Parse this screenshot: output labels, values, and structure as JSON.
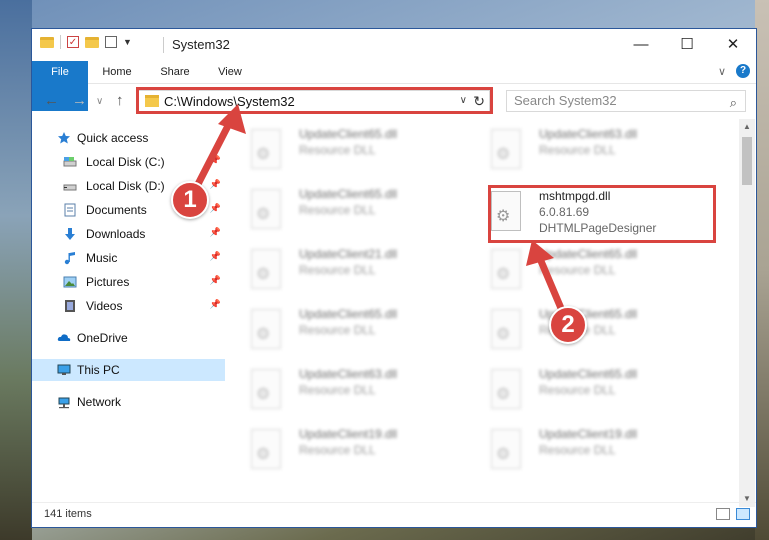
{
  "window": {
    "title": "System32",
    "minimize_glyph": "—",
    "maximize_glyph": "☐",
    "close_glyph": "✕"
  },
  "ribbon": {
    "tabs": [
      "File",
      "Home",
      "Share",
      "View"
    ],
    "expand_glyph": "∨",
    "help_glyph": "?"
  },
  "nav": {
    "back_glyph": "←",
    "forward_glyph": "→",
    "recent_glyph": "∨",
    "up_glyph": "↑",
    "address": "C:\\Windows\\System32",
    "address_caret": "∨",
    "refresh_glyph": "↻",
    "search_placeholder": "Search System32",
    "search_glyph": "⌕"
  },
  "sidebar": {
    "items": [
      {
        "label": "Quick access",
        "icon": "star-icon"
      },
      {
        "label": "Local Disk (C:)",
        "icon": "drive-icon"
      },
      {
        "label": "Local Disk (D:)",
        "icon": "drive-icon"
      },
      {
        "label": "Documents",
        "icon": "documents-icon"
      },
      {
        "label": "Downloads",
        "icon": "download-icon"
      },
      {
        "label": "Music",
        "icon": "music-icon"
      },
      {
        "label": "Pictures",
        "icon": "pictures-icon"
      },
      {
        "label": "Videos",
        "icon": "videos-icon"
      },
      {
        "label": "OneDrive",
        "icon": "cloud-icon"
      },
      {
        "label": "This PC",
        "icon": "computer-icon"
      },
      {
        "label": "Network",
        "icon": "network-icon"
      }
    ],
    "pin_glyph": "📌"
  },
  "files": [
    {
      "name": "UpdateClient65.dll",
      "type": "Resource DLL"
    },
    {
      "name": "UpdateClient63.dll",
      "type": "Resource DLL"
    },
    {
      "name": "UpdateClient65.dll",
      "type": "Resource DLL"
    },
    {
      "name": "mshtmpgd.dll",
      "version": "6.0.81.69",
      "description": "DHTMLPageDesigner"
    },
    {
      "name": "UpdateClient21.dll",
      "type": "Resource DLL"
    },
    {
      "name": "UpdateClient65.dll",
      "type": "Resource DLL"
    },
    {
      "name": "UpdateClient65.dll",
      "type": "Resource DLL"
    },
    {
      "name": "UpdateClient65.dll",
      "type": "Resource DLL"
    },
    {
      "name": "UpdateClient63.dll",
      "type": "Resource DLL"
    },
    {
      "name": "UpdateClient65.dll",
      "type": "Resource DLL"
    },
    {
      "name": "UpdateClient19.dll",
      "type": "Resource DLL"
    },
    {
      "name": "UpdateClient19.dll",
      "type": "Resource DLL"
    }
  ],
  "status": {
    "items_count": "141 items"
  },
  "annotations": {
    "step1": "1",
    "step2": "2",
    "color": "#d9443f"
  },
  "colors": {
    "accent": "#1979ca",
    "selection": "#cce8ff"
  }
}
